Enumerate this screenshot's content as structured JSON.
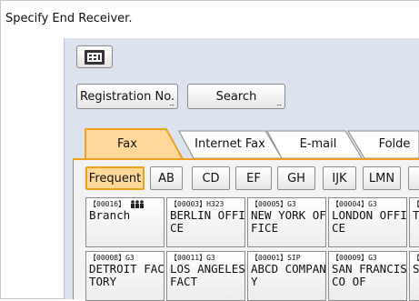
{
  "prompt": "Specify End Receiver.",
  "buttons": {
    "registration": "Registration No.",
    "search": "Search"
  },
  "tabs": [
    {
      "label": "Fax",
      "active": true
    },
    {
      "label": "Internet Fax",
      "active": false
    },
    {
      "label": "E-mail",
      "active": false
    },
    {
      "label": "Folde",
      "active": false
    }
  ],
  "key_tabs": [
    "Frequent",
    "AB",
    "CD",
    "EF",
    "GH",
    "IJK",
    "LMN"
  ],
  "entries": [
    {
      "code": "【00016】",
      "icon": "group-icon",
      "name": "Branch"
    },
    {
      "code": "【00003】H323",
      "name": "BERLIN OFFICE"
    },
    {
      "code": "【00005】G3",
      "name": "NEW YORK OFFICE"
    },
    {
      "code": "【00004】G3",
      "name": "LONDON OFFICE"
    },
    {
      "code": "【",
      "name": "TF"
    },
    {
      "code": "【00008】G3",
      "name": "DETROIT FACTORY"
    },
    {
      "code": "【00011】G3",
      "name": "LOS ANGELES FACT"
    },
    {
      "code": "【00001】SIP",
      "name": "ABCD COMPANY"
    },
    {
      "code": "【00009】G3",
      "name": "SAN FRANCISCO OF"
    },
    {
      "code": "【",
      "name": "SI"
    }
  ],
  "colors": {
    "accent": "#f0a020",
    "active_tab": "#ffd89a",
    "panel": "#dde2ef"
  }
}
